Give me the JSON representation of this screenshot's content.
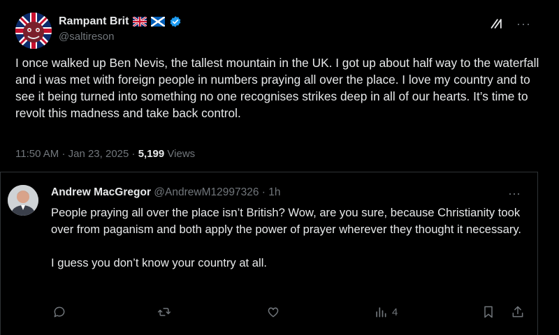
{
  "post": {
    "author_name": "Rampant Brit",
    "handle": "@saltireson",
    "flags": [
      "uk-flag-icon",
      "scotland-flag-icon"
    ],
    "text": "I once walked up Ben Nevis, the tallest mountain in the UK. I got up about half way to the waterfall and i was met with foreign people in numbers praying all over the place. I love my country and to see it being turned into something no one recognises strikes deep in all of our hearts. It’s time to revolt this madness and take back control.",
    "time": "11:50 AM",
    "date": "Jan 23, 2025",
    "separator": "·",
    "views_count": "5,199",
    "views_label": "Views",
    "more_label": "···"
  },
  "reply": {
    "author_name": "Andrew MacGregor",
    "handle": "@AndrewM12997326",
    "age": "1h",
    "separator": "·",
    "text_para1": "People praying all over the place isn’t British? Wow, are you sure, because Christianity took over from paganism and both apply the power of prayer wherever they thought it necessary.",
    "text_para2": "I guess you don’t know your country at all.",
    "views_count": "4",
    "more_label": "···"
  },
  "colors": {
    "background": "#000000",
    "text": "#e7e9ea",
    "muted": "#71767b",
    "verified": "#1d9bf0",
    "border": "#2f3336"
  }
}
